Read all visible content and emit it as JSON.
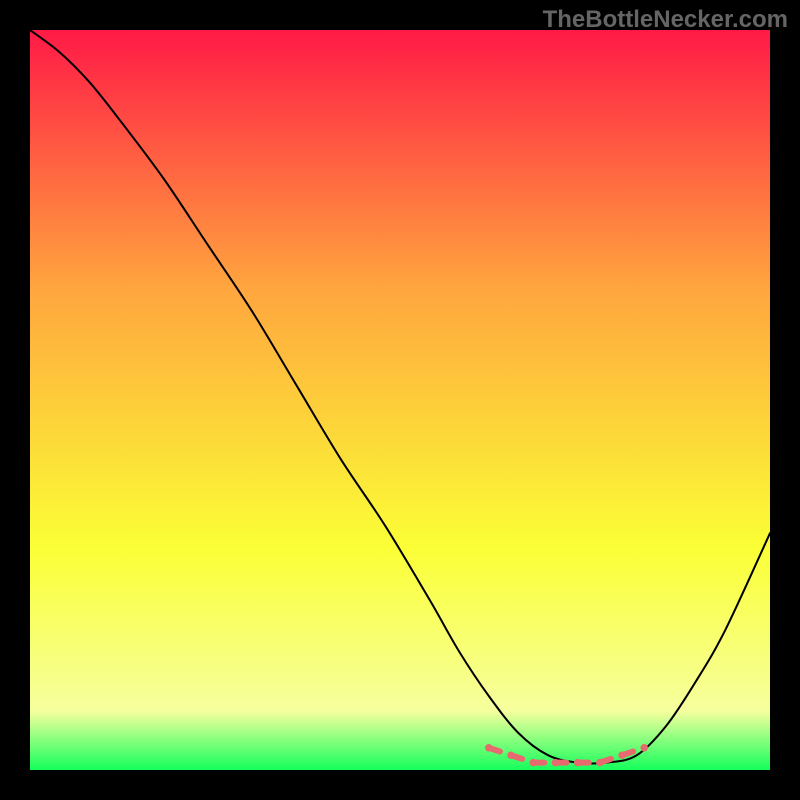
{
  "watermark": "TheBottleNecker.com",
  "chart_data": {
    "type": "line",
    "title": "",
    "xlabel": "",
    "ylabel": "",
    "xlim": [
      0,
      100
    ],
    "ylim": [
      0,
      100
    ],
    "grid": false,
    "legend": false,
    "background_gradient": {
      "top": "#ff1a46",
      "mid_upper": "#ffa63e",
      "mid_lower": "#fbff36",
      "bottom_band": "#f6ff9e",
      "bottom_edge": "#15ff5c"
    },
    "series": [
      {
        "name": "black-curve",
        "color": "#000000",
        "stroke_width": 2,
        "x": [
          0,
          4,
          8,
          12,
          18,
          24,
          30,
          36,
          42,
          48,
          54,
          58,
          62,
          66,
          70,
          74,
          78,
          82,
          86,
          90,
          94,
          100
        ],
        "y": [
          100,
          97,
          93,
          88,
          80,
          71,
          62,
          52,
          42,
          33,
          23,
          16,
          10,
          5,
          2,
          1,
          1,
          2,
          6,
          12,
          19,
          32
        ]
      },
      {
        "name": "pink-valley-marker",
        "color": "#e76a6e",
        "stroke_width": 6,
        "dotted": true,
        "x": [
          62,
          65,
          68,
          71,
          74,
          77,
          80,
          83
        ],
        "y": [
          3,
          2,
          1,
          1,
          1,
          1,
          2,
          3
        ]
      }
    ]
  }
}
